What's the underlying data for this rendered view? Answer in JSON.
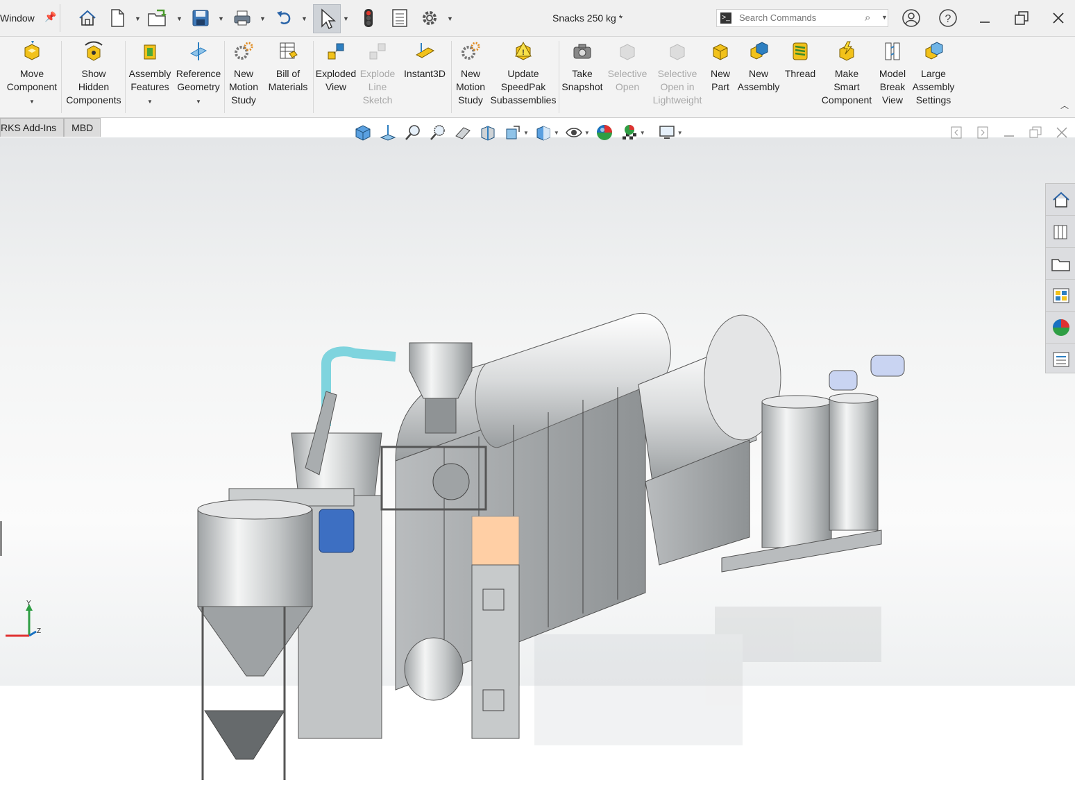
{
  "titlebar": {
    "menu_label": "Window",
    "document_title": "Snacks 250 kg *",
    "search_placeholder": "Search Commands"
  },
  "ribbon": {
    "tools": [
      {
        "name": "move-component",
        "label": "Move\nComponent",
        "icon": "move-component-icon",
        "enabled": true,
        "dropdown": true
      },
      {
        "name": "show-hidden-components",
        "label": "Show\nHidden\nComponents",
        "icon": "show-hidden-icon",
        "enabled": true,
        "dropdown": false
      },
      {
        "name": "assembly-features",
        "label": "Assembly\nFeatures",
        "icon": "assembly-features-icon",
        "enabled": true,
        "dropdown": true
      },
      {
        "name": "reference-geometry",
        "label": "Reference\nGeometry",
        "icon": "reference-geometry-icon",
        "enabled": true,
        "dropdown": true
      },
      {
        "name": "new-motion-study-1",
        "label": "New\nMotion\nStudy",
        "icon": "motion-study-icon",
        "enabled": true,
        "dropdown": false
      },
      {
        "name": "bill-of-materials",
        "label": "Bill of\nMaterials",
        "icon": "bom-icon",
        "enabled": true,
        "dropdown": false
      },
      {
        "name": "exploded-view",
        "label": "Exploded\nView",
        "icon": "exploded-view-icon",
        "enabled": true,
        "dropdown": false
      },
      {
        "name": "explode-line-sketch",
        "label": "Explode\nLine\nSketch",
        "icon": "explode-line-icon",
        "enabled": false,
        "dropdown": false
      },
      {
        "name": "instant3d",
        "label": "Instant3D",
        "icon": "instant3d-icon",
        "enabled": true,
        "dropdown": false
      },
      {
        "name": "new-motion-study-2",
        "label": "New\nMotion\nStudy",
        "icon": "motion-study-icon",
        "enabled": true,
        "dropdown": false
      },
      {
        "name": "update-speedpak",
        "label": "Update\nSpeedPak\nSubassemblies",
        "icon": "speedpak-icon",
        "enabled": true,
        "dropdown": false
      },
      {
        "name": "take-snapshot",
        "label": "Take\nSnapshot",
        "icon": "camera-icon",
        "enabled": true,
        "dropdown": false
      },
      {
        "name": "selective-open",
        "label": "Selective\nOpen",
        "icon": "selective-open-icon",
        "enabled": false,
        "dropdown": false
      },
      {
        "name": "selective-open-lightweight",
        "label": "Selective\nOpen in\nLightweight",
        "icon": "selective-open-lw-icon",
        "enabled": false,
        "dropdown": false
      },
      {
        "name": "new-part",
        "label": "New\nPart",
        "icon": "new-part-icon",
        "enabled": true,
        "dropdown": false
      },
      {
        "name": "new-assembly",
        "label": "New\nAssembly",
        "icon": "new-assembly-icon",
        "enabled": true,
        "dropdown": false
      },
      {
        "name": "thread",
        "label": "Thread",
        "icon": "thread-icon",
        "enabled": true,
        "dropdown": false
      },
      {
        "name": "make-smart-component",
        "label": "Make\nSmart\nComponent",
        "icon": "smart-component-icon",
        "enabled": true,
        "dropdown": false
      },
      {
        "name": "model-break-view",
        "label": "Model\nBreak\nView",
        "icon": "break-view-icon",
        "enabled": true,
        "dropdown": false
      },
      {
        "name": "large-assembly-settings",
        "label": "Large\nAssembly\nSettings",
        "icon": "large-assembly-icon",
        "enabled": true,
        "dropdown": false
      }
    ]
  },
  "tabs": [
    {
      "label": "RKS Add-Ins"
    },
    {
      "label": "MBD"
    }
  ],
  "triad": {
    "y": "Y",
    "z": "Z"
  },
  "colors": {
    "ribbon_bg": "#f3f3f3",
    "icon_yellow": "#f2c21b",
    "icon_blue": "#2d7fc1",
    "accent_cyan": "#7fd4de",
    "model_steel": "#c8cbcc"
  }
}
